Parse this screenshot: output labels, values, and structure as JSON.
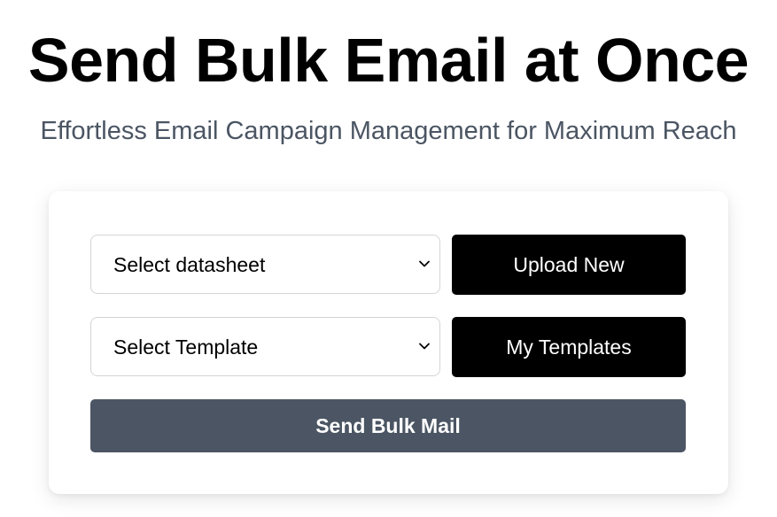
{
  "header": {
    "title": "Send Bulk Email at Once",
    "subtitle": "Effortless Email Campaign Management for Maximum Reach"
  },
  "form": {
    "datasheet_select": {
      "selected": "Select datasheet",
      "icon": "chevron-down-icon"
    },
    "upload_button_label": "Upload New",
    "template_select": {
      "selected": "Select Template",
      "icon": "chevron-down-icon"
    },
    "templates_button_label": "My Templates",
    "send_button_label": "Send Bulk Mail"
  },
  "colors": {
    "primary_button": "#000000",
    "send_button": "#4b5563",
    "subtitle_text": "#4b5563",
    "card_background": "#ffffff"
  }
}
